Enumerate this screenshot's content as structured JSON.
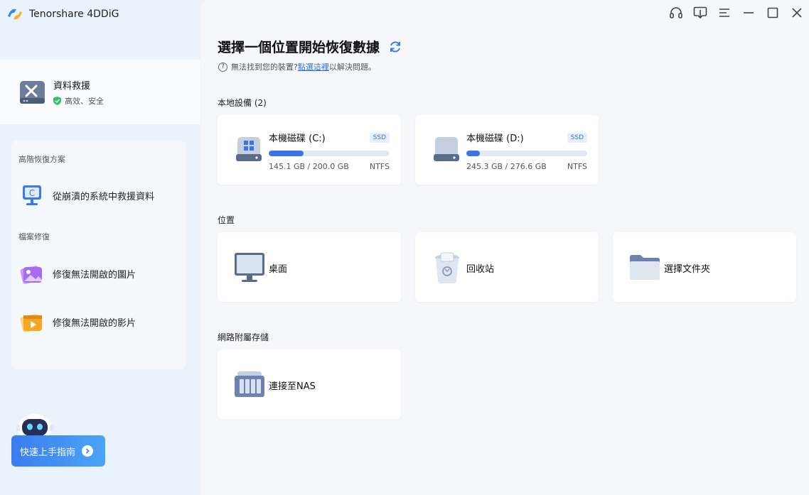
{
  "app": {
    "name": "Tenorshare 4DDiG"
  },
  "sidebar": {
    "primary": {
      "title": "資料救援",
      "subtitle": "高效、安全"
    },
    "advanced_label": "高階恢復方案",
    "crash_item": "從崩潰的系統中救援資料",
    "repair_label": "檔案修復",
    "repair_photo": "修復無法開啟的圖片",
    "repair_video": "修復無法開啟的影片",
    "guide_button": "快速上手指南"
  },
  "main": {
    "heading": "選擇一個位置開始恢復數據",
    "note_prefix": "無法找到您的裝置?",
    "note_link": "點選這裡",
    "note_suffix": "以解決問題。",
    "local_label": "本地設備 (2)",
    "drives": [
      {
        "name": "本機磁碟 (C:)",
        "badge": "SSD",
        "size": "145.1 GB / 200.0 GB",
        "fs": "NTFS",
        "used_fraction": 0.29
      },
      {
        "name": "本機磁碟 (D:)",
        "badge": "SSD",
        "size": "245.3 GB / 276.6 GB",
        "fs": "NTFS",
        "used_fraction": 0.11
      }
    ],
    "location_label": "位置",
    "locations": [
      {
        "name": "桌面"
      },
      {
        "name": "回收站"
      },
      {
        "name": "選擇文件夾"
      }
    ],
    "nas_label": "網路附屬存儲",
    "nas": {
      "name": "連接至NAS"
    }
  },
  "colors": {
    "accent": "#3a74e8",
    "link": "#2f6fe0",
    "sidebar_bg": "#eaf2fb",
    "main_bg": "#f5f7fa"
  },
  "icons": [
    "headset-icon",
    "download-icon",
    "menu-icon",
    "minimize-icon",
    "maximize-icon",
    "close-icon",
    "refresh-icon"
  ]
}
